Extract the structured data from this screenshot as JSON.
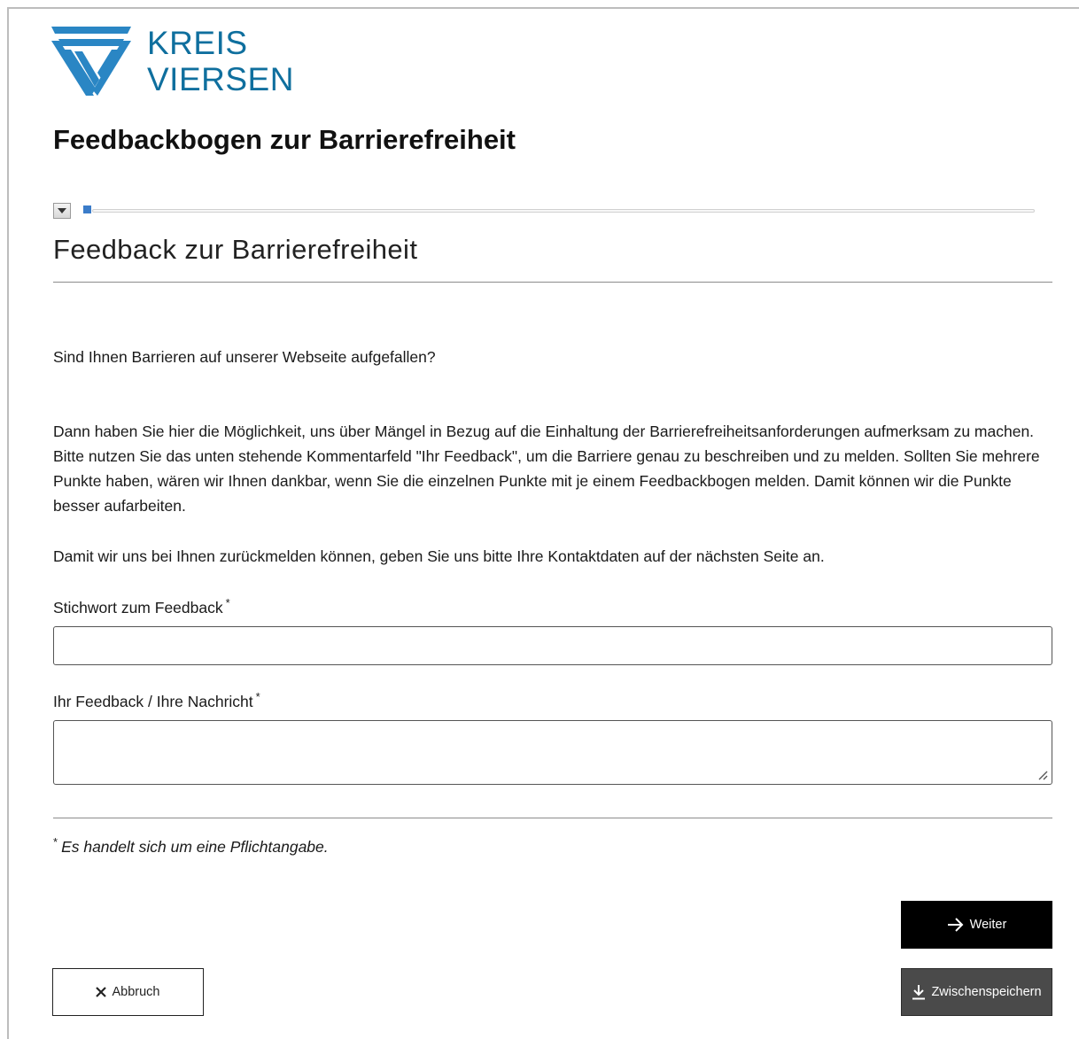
{
  "brand": {
    "logo_icon": "kreis-viersen-logo-icon",
    "name_line1": "KREIS",
    "name_line2": "VIERSEN",
    "color": "#0f6f9e"
  },
  "app_title": "Feedbackbogen zur Barrierefreiheit",
  "progress": {
    "current_step": 1,
    "fraction": 0.01,
    "color": "#3b7cc9",
    "toggle_icon": "chevron-down-icon"
  },
  "page": {
    "heading": "Feedback zur Barrierefreiheit",
    "question": "Sind Ihnen Barrieren auf unserer Webseite aufgefallen?",
    "paragraph": "Dann haben Sie hier die Möglichkeit, uns über Mängel in Bezug auf die Einhaltung der Barrierefreiheitsanforderungen aufmerksam zu machen. Bitte nutzen Sie das unten stehende Kommentarfeld \"Ihr Feedback\", um die Barriere genau zu beschreiben und zu melden. Sollten Sie mehrere Punkte haben, wären wir Ihnen dankbar, wenn Sie die einzelnen Punkte mit je einem Feedbackbogen melden. Damit können wir die Punkte besser aufarbeiten.",
    "contact_note": "Damit wir uns bei Ihnen zurückmelden können, geben Sie uns bitte Ihre Kontaktdaten auf der nächsten Seite an."
  },
  "fields": {
    "keyword": {
      "label": "Stichwort zum Feedback",
      "required_mark": "*",
      "value": "",
      "placeholder": ""
    },
    "message": {
      "label": "Ihr Feedback / Ihre Nachricht",
      "required_mark": "*",
      "value": "",
      "placeholder": ""
    }
  },
  "required_note": {
    "mark": "*",
    "text": "Es handelt sich um eine Pflichtangabe."
  },
  "buttons": {
    "next": {
      "label": "Weiter",
      "icon": "arrow-right-icon"
    },
    "save": {
      "label": "Zwischenspeichern",
      "icon": "download-icon"
    },
    "cancel": {
      "label": "Abbruch",
      "icon": "close-icon"
    }
  }
}
